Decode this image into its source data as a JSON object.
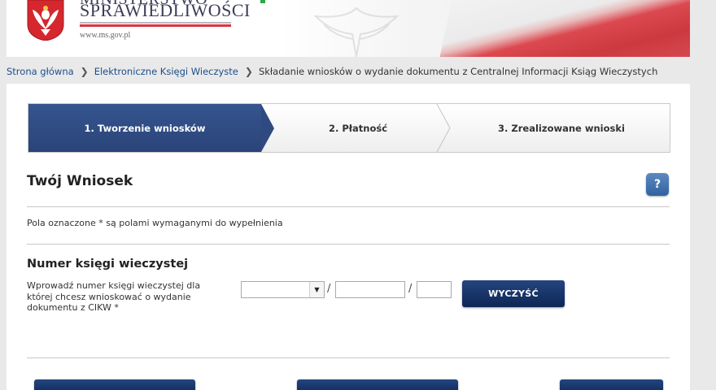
{
  "header": {
    "title_top": "MINISTERSTWO",
    "title": "SPRAWIEDLIWOŚCI",
    "url": "www.ms.gov.pl"
  },
  "breadcrumb": {
    "items": [
      "Strona główna",
      "Elektroniczne Księgi Wieczyste"
    ],
    "current": "Składanie wniosków o wydanie dokumentu z Centralnej Informacji Ksiąg Wieczystych"
  },
  "steps": [
    {
      "label": "1. Tworzenie wniosków",
      "active": true
    },
    {
      "label": "2. Płatność",
      "active": false
    },
    {
      "label": "3. Zrealizowane wnioski",
      "active": false
    }
  ],
  "form": {
    "title": "Twój Wniosek",
    "help": "?",
    "required_note": "Pola oznaczone * są polami wymaganymi do wypełnienia",
    "subtitle": "Numer księgi wieczystej",
    "field_label": "Wprowadź numer księgi wieczystej dla której chcesz wnioskować o wydanie dokumentu z CIKW *",
    "court_code_value": "",
    "register_number_value": "",
    "check_digit_value": "",
    "clear_button": "WYCZYŚĆ"
  },
  "icons": {
    "emblem": "polish-eagle-emblem-icon",
    "select_arrow": "triangle-down-icon",
    "breadcrumb_sep": "chevron-right-icon"
  },
  "colors": {
    "accent": "#2a4478",
    "button": "#0e2655",
    "help": "#32629f",
    "flag_red": "#d9363e"
  }
}
